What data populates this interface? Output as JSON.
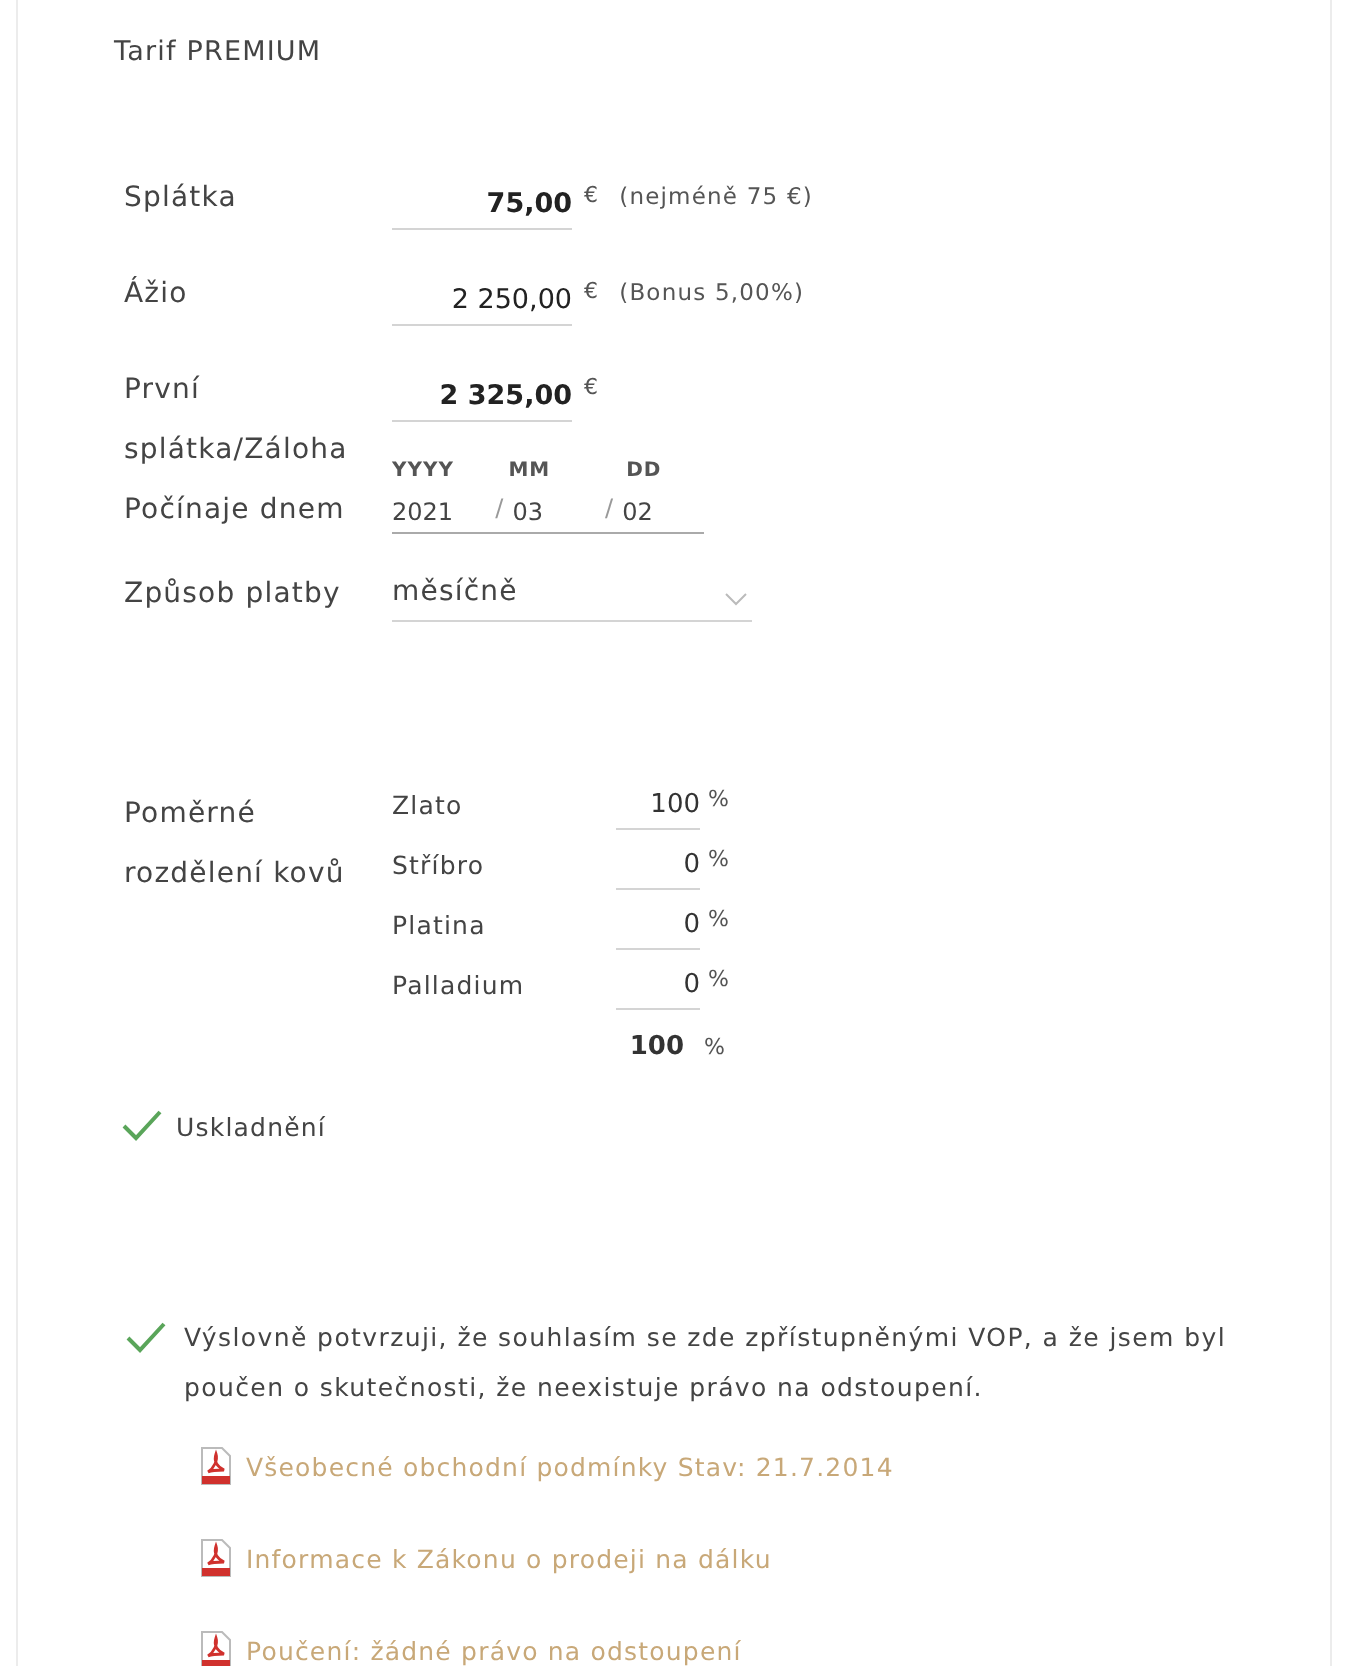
{
  "title": "Tarif PREMIUM",
  "amounts": [
    {
      "label": "Splátka",
      "value": "75,00",
      "currency": "€",
      "note": "(nejméně 75 €)",
      "emphasized": true
    },
    {
      "label": "Ážio",
      "value": "2 250,00",
      "currency": "€",
      "note": "(Bonus 5,00%)",
      "emphasized": false
    },
    {
      "label": "První splátka/Záloha",
      "value": "2 325,00",
      "currency": "€",
      "emphasized": true
    }
  ],
  "start_date": {
    "label": "Počínaje dnem",
    "parts": [
      {
        "heading": "YYYY",
        "value": "2021"
      },
      {
        "heading": "MM",
        "value": "03",
        "separator": "/"
      },
      {
        "heading": "DD",
        "value": "02",
        "separator": "/"
      }
    ]
  },
  "payment": {
    "label": "Způsob platby",
    "value": "měsíčně"
  },
  "metals": {
    "label": "Poměrné rozdělení kovů",
    "items": [
      {
        "name": "Zlato",
        "value": "100",
        "unit": "%"
      },
      {
        "name": "Stříbro",
        "value": "0",
        "unit": "%"
      },
      {
        "name": "Platina",
        "value": "0",
        "unit": "%"
      },
      {
        "name": "Palladium",
        "value": "0",
        "unit": "%"
      }
    ],
    "total": "100",
    "total_unit": "%"
  },
  "storage": {
    "label": "Uskladnění",
    "checked": true
  },
  "consent": {
    "text": "Výslovně potvrzuji, že souhlasím se zde zpřístupněnými VOP, a že jsem byl poučen o skutečnosti, že neexistuje právo na odstoupení.",
    "checked": true
  },
  "documents": [
    {
      "label": "Všeobecné obchodní podmínky Stav: 21.7.2014"
    },
    {
      "label": "Informace k Zákonu o prodeji na dálku"
    },
    {
      "label": "Poučení: žádné právo na odstoupení"
    }
  ]
}
